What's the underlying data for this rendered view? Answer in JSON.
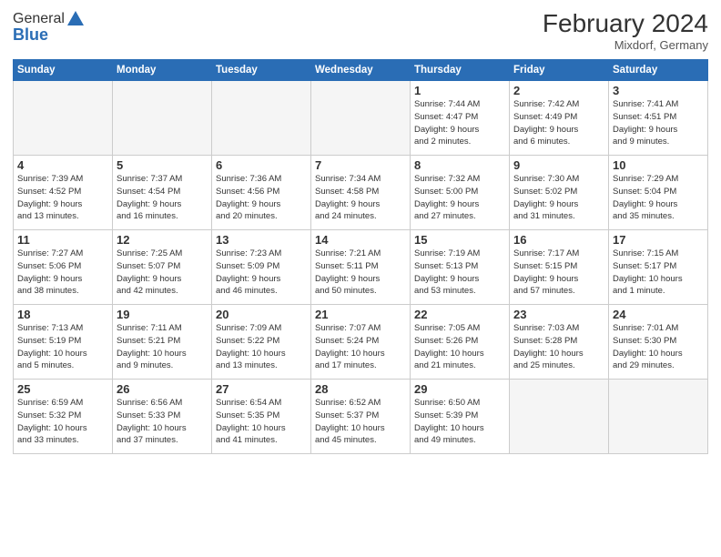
{
  "header": {
    "logo_general": "General",
    "logo_blue": "Blue",
    "month_title": "February 2024",
    "location": "Mixdorf, Germany"
  },
  "weekdays": [
    "Sunday",
    "Monday",
    "Tuesday",
    "Wednesday",
    "Thursday",
    "Friday",
    "Saturday"
  ],
  "weeks": [
    [
      {
        "day": "",
        "info": ""
      },
      {
        "day": "",
        "info": ""
      },
      {
        "day": "",
        "info": ""
      },
      {
        "day": "",
        "info": ""
      },
      {
        "day": "1",
        "info": "Sunrise: 7:44 AM\nSunset: 4:47 PM\nDaylight: 9 hours\nand 2 minutes."
      },
      {
        "day": "2",
        "info": "Sunrise: 7:42 AM\nSunset: 4:49 PM\nDaylight: 9 hours\nand 6 minutes."
      },
      {
        "day": "3",
        "info": "Sunrise: 7:41 AM\nSunset: 4:51 PM\nDaylight: 9 hours\nand 9 minutes."
      }
    ],
    [
      {
        "day": "4",
        "info": "Sunrise: 7:39 AM\nSunset: 4:52 PM\nDaylight: 9 hours\nand 13 minutes."
      },
      {
        "day": "5",
        "info": "Sunrise: 7:37 AM\nSunset: 4:54 PM\nDaylight: 9 hours\nand 16 minutes."
      },
      {
        "day": "6",
        "info": "Sunrise: 7:36 AM\nSunset: 4:56 PM\nDaylight: 9 hours\nand 20 minutes."
      },
      {
        "day": "7",
        "info": "Sunrise: 7:34 AM\nSunset: 4:58 PM\nDaylight: 9 hours\nand 24 minutes."
      },
      {
        "day": "8",
        "info": "Sunrise: 7:32 AM\nSunset: 5:00 PM\nDaylight: 9 hours\nand 27 minutes."
      },
      {
        "day": "9",
        "info": "Sunrise: 7:30 AM\nSunset: 5:02 PM\nDaylight: 9 hours\nand 31 minutes."
      },
      {
        "day": "10",
        "info": "Sunrise: 7:29 AM\nSunset: 5:04 PM\nDaylight: 9 hours\nand 35 minutes."
      }
    ],
    [
      {
        "day": "11",
        "info": "Sunrise: 7:27 AM\nSunset: 5:06 PM\nDaylight: 9 hours\nand 38 minutes."
      },
      {
        "day": "12",
        "info": "Sunrise: 7:25 AM\nSunset: 5:07 PM\nDaylight: 9 hours\nand 42 minutes."
      },
      {
        "day": "13",
        "info": "Sunrise: 7:23 AM\nSunset: 5:09 PM\nDaylight: 9 hours\nand 46 minutes."
      },
      {
        "day": "14",
        "info": "Sunrise: 7:21 AM\nSunset: 5:11 PM\nDaylight: 9 hours\nand 50 minutes."
      },
      {
        "day": "15",
        "info": "Sunrise: 7:19 AM\nSunset: 5:13 PM\nDaylight: 9 hours\nand 53 minutes."
      },
      {
        "day": "16",
        "info": "Sunrise: 7:17 AM\nSunset: 5:15 PM\nDaylight: 9 hours\nand 57 minutes."
      },
      {
        "day": "17",
        "info": "Sunrise: 7:15 AM\nSunset: 5:17 PM\nDaylight: 10 hours\nand 1 minute."
      }
    ],
    [
      {
        "day": "18",
        "info": "Sunrise: 7:13 AM\nSunset: 5:19 PM\nDaylight: 10 hours\nand 5 minutes."
      },
      {
        "day": "19",
        "info": "Sunrise: 7:11 AM\nSunset: 5:21 PM\nDaylight: 10 hours\nand 9 minutes."
      },
      {
        "day": "20",
        "info": "Sunrise: 7:09 AM\nSunset: 5:22 PM\nDaylight: 10 hours\nand 13 minutes."
      },
      {
        "day": "21",
        "info": "Sunrise: 7:07 AM\nSunset: 5:24 PM\nDaylight: 10 hours\nand 17 minutes."
      },
      {
        "day": "22",
        "info": "Sunrise: 7:05 AM\nSunset: 5:26 PM\nDaylight: 10 hours\nand 21 minutes."
      },
      {
        "day": "23",
        "info": "Sunrise: 7:03 AM\nSunset: 5:28 PM\nDaylight: 10 hours\nand 25 minutes."
      },
      {
        "day": "24",
        "info": "Sunrise: 7:01 AM\nSunset: 5:30 PM\nDaylight: 10 hours\nand 29 minutes."
      }
    ],
    [
      {
        "day": "25",
        "info": "Sunrise: 6:59 AM\nSunset: 5:32 PM\nDaylight: 10 hours\nand 33 minutes."
      },
      {
        "day": "26",
        "info": "Sunrise: 6:56 AM\nSunset: 5:33 PM\nDaylight: 10 hours\nand 37 minutes."
      },
      {
        "day": "27",
        "info": "Sunrise: 6:54 AM\nSunset: 5:35 PM\nDaylight: 10 hours\nand 41 minutes."
      },
      {
        "day": "28",
        "info": "Sunrise: 6:52 AM\nSunset: 5:37 PM\nDaylight: 10 hours\nand 45 minutes."
      },
      {
        "day": "29",
        "info": "Sunrise: 6:50 AM\nSunset: 5:39 PM\nDaylight: 10 hours\nand 49 minutes."
      },
      {
        "day": "",
        "info": ""
      },
      {
        "day": "",
        "info": ""
      }
    ]
  ]
}
